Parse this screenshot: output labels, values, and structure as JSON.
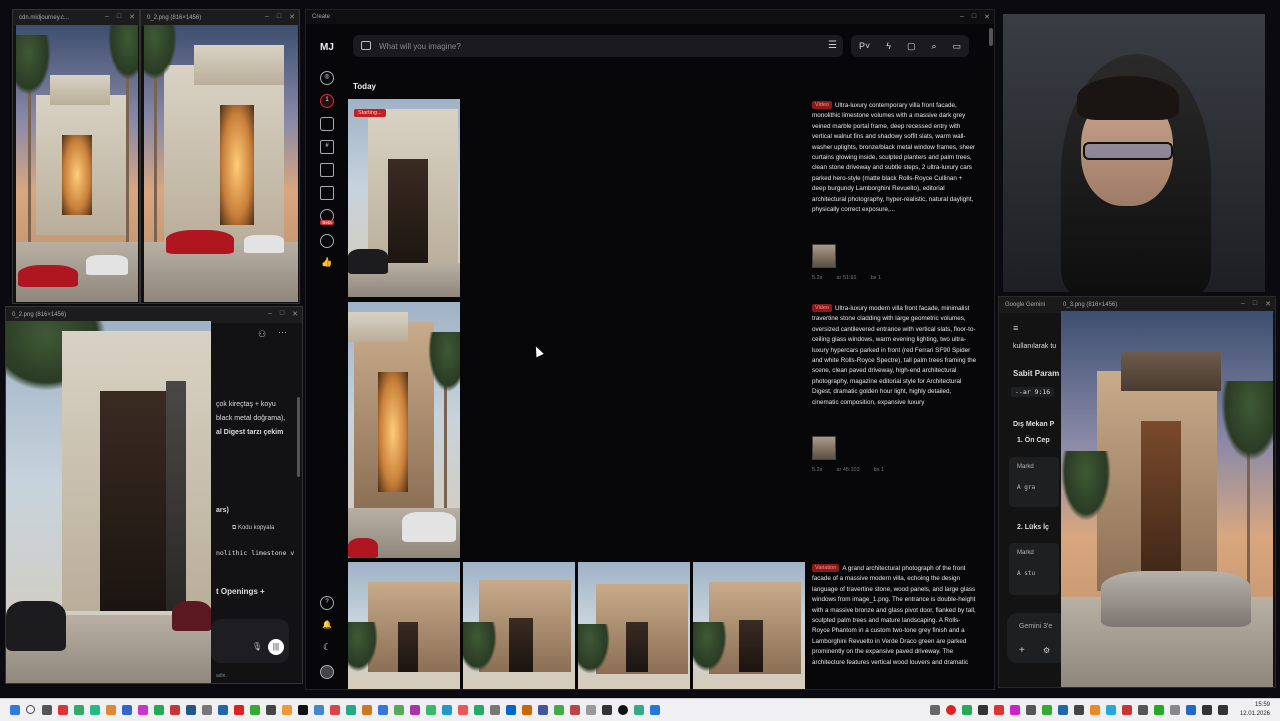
{
  "windows": {
    "left_top_a": {
      "title": "cdn.midjourney.c..."
    },
    "left_top_b": {
      "title": "0_2.png (816×1456)"
    },
    "left_bottom": {
      "title": "0_2.png (816×1456)"
    },
    "mj": {
      "title": "Create"
    },
    "gemini": {
      "title": "Google Gemini",
      "image_title": "0_3.png (816×1456)"
    }
  },
  "mj": {
    "logo": "MJ",
    "search_placeholder": "What will you imagine?",
    "notification_count": "1",
    "beta_label": "Beta",
    "section_title": "Today",
    "starting_label": "Starting...",
    "jobs": [
      {
        "badge": "Video",
        "prompt": "Ultra-luxury contemporary villa front facade, monolithic limestone volumes with a massive dark grey veined marble portal frame, deep recessed entry with vertical walnut fins and shadowy soffit slats, warm wall-washer uplights, bronze/black metal window frames, sheer curtains glowing inside, sculpted planters and palm trees, clean stone driveway and subtle steps, 2 ultra-luxury cars parked hero-style (matte black Rolls-Royce Cullinan + deep burgundy Lamborghini Revuelto), editorial architectural photography, hyper-realistic, natural daylight, physically correct exposure,...",
        "meta": [
          "5.2s",
          "ar 51:91",
          "bs 1"
        ]
      },
      {
        "badge": "Video",
        "prompt": "Ultra-luxury modern villa front facade, minimalist travertine stone cladding with large geometric volumes, oversized cantilevered entrance with vertical slats, floor-to-ceiling glass windows, warm evening lighting, two ultra-luxury hypercars parked in front (red Ferrari SF90 Spider and white Rolls-Royce Spectre), tall palm trees framing the scene, clean paved driveway, high-end architectural photography, magazine editorial style for Architectural Digest, dramatic golden hour light, highly detailed, cinematic composition, expansive luxury",
        "meta": [
          "5.2s",
          "ar 45:103",
          "bs 1"
        ]
      },
      {
        "badge": "Variation",
        "prompt": "A grand architectural photograph of the front facade of a massive modern villa, echoing the design language of travertine stone, wood panels, and large glass windows from image_1.png. The entrance is double-height with a massive bronze and glass pivot door, flanked by tall, sculpted palm trees and mature landscaping. A Rolls-Royce Phantom in a custom two-tone grey finish and a Lamborghini Revuelto in Verde Draco green are parked prominently on the expansive paved driveway. The architecture features vertical wood louvers and dramatic"
      }
    ]
  },
  "gemini": {
    "lines": [
      "kullanılarak tu",
      "Sabit Param",
      "--ar 9:16",
      "Dış Mekan P",
      "1.  Ön Cep",
      "Markd",
      "A gra",
      "2.  Lüks İç",
      "Markd",
      "A stu",
      "Gemini 3'e"
    ]
  },
  "chat": {
    "lines": [
      "çok kireçtaş + koyu",
      "black metal doğrama),",
      "al Digest tarzı çekim",
      "ars)",
      "nolithic limestone v",
      "t Openings +",
      "adin."
    ],
    "copy_label": "Kodu kopyala"
  },
  "taskbar": {
    "time": "15:59",
    "date": "12.01.2026"
  }
}
